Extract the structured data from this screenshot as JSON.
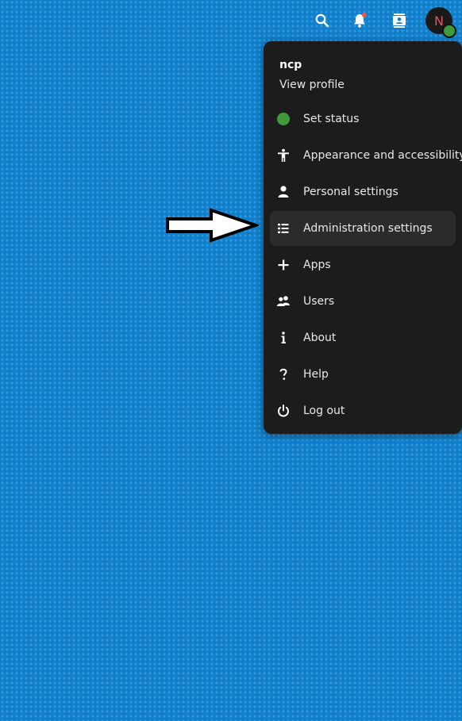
{
  "colors": {
    "background": "#0f7fcc",
    "menu_background": "#1c1c1c",
    "status_online": "#3e9a3a",
    "notification_dot": "#e8574b",
    "avatar_letter": "#e0555d"
  },
  "header": {
    "icons": [
      "search-icon",
      "bell-icon",
      "contacts-icon"
    ],
    "avatar_initial": "N"
  },
  "menu": {
    "user_name": "ncp",
    "view_profile": "View profile",
    "items": [
      {
        "label": "Set status",
        "icon": "status-dot-icon"
      },
      {
        "label": "Appearance and accessibility",
        "icon": "accessibility-icon"
      },
      {
        "label": "Personal settings",
        "icon": "person-icon"
      },
      {
        "label": "Administration settings",
        "icon": "list-icon"
      },
      {
        "label": "Apps",
        "icon": "plus-icon"
      },
      {
        "label": "Users",
        "icon": "users-icon"
      },
      {
        "label": "About",
        "icon": "info-icon"
      },
      {
        "label": "Help",
        "icon": "help-icon"
      },
      {
        "label": "Log out",
        "icon": "power-icon"
      }
    ]
  }
}
